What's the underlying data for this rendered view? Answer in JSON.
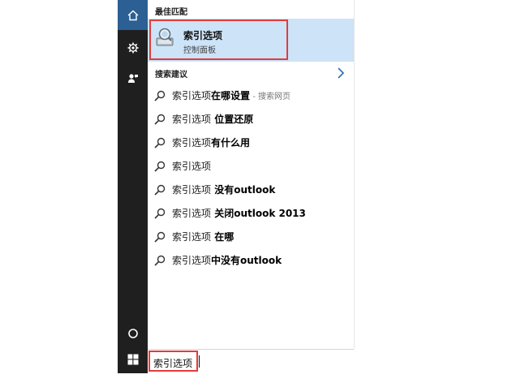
{
  "window": {
    "type": "Windows 10 Start search"
  },
  "sidebar": {
    "items": [
      {
        "name": "home",
        "icon": "home-icon"
      },
      {
        "name": "settings",
        "icon": "gear-icon"
      },
      {
        "name": "feedback",
        "icon": "feedback-icon"
      },
      {
        "name": "cortana",
        "icon": "circle-icon"
      },
      {
        "name": "start",
        "icon": "windows-icon"
      }
    ]
  },
  "best_match": {
    "section_label": "最佳匹配",
    "title": "索引选项",
    "subtitle": "控制面板",
    "icon": "indexing-options-icon"
  },
  "suggestions": {
    "section_label": "搜索建议",
    "items": [
      {
        "prefix": "索引选项",
        "bold": "在哪设置",
        "hint": " - 搜索网页"
      },
      {
        "prefix": "索引选项",
        "bold": " 位置还原",
        "hint": ""
      },
      {
        "prefix": "索引选项",
        "bold": "有什么用",
        "hint": ""
      },
      {
        "prefix": "索引选项",
        "bold": "",
        "hint": ""
      },
      {
        "prefix": "索引选项",
        "bold": " 没有outlook",
        "hint": ""
      },
      {
        "prefix": "索引选项",
        "bold": " 关闭outlook 2013",
        "hint": ""
      },
      {
        "prefix": "索引选项",
        "bold": " 在哪",
        "hint": ""
      },
      {
        "prefix": "索引选项",
        "bold": "中没有outlook",
        "hint": ""
      }
    ]
  },
  "search": {
    "value": "索引选项"
  },
  "colors": {
    "accent": "#2c5f93",
    "highlight": "#cde3f7",
    "annotation": "#e03c3c",
    "sidebar": "#1f1f1f"
  }
}
